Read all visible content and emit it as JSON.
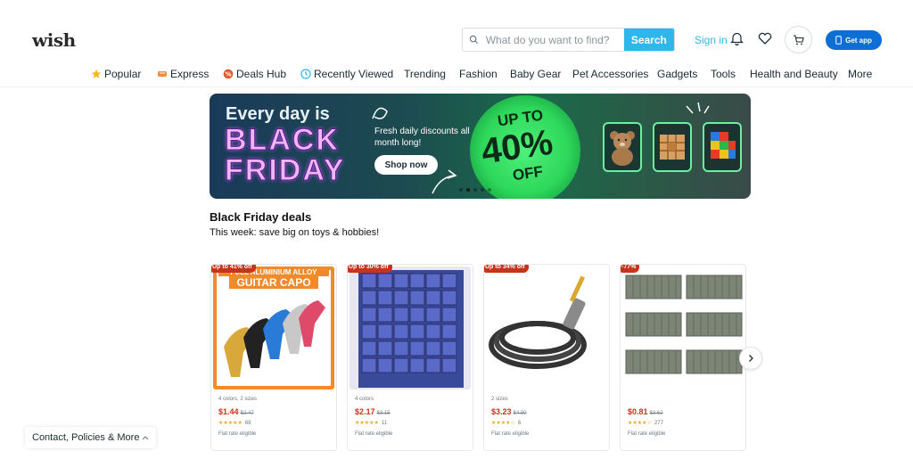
{
  "header": {
    "logo": "wish",
    "search": {
      "placeholder": "What do you want to find?",
      "value": "",
      "button": "Search"
    },
    "sign_in": "Sign in",
    "get_app": "Get app"
  },
  "nav": {
    "items": [
      {
        "label": "Popular",
        "icon": "star-icon"
      },
      {
        "label": "Express",
        "icon": "express-icon"
      },
      {
        "label": "Deals Hub",
        "icon": "deals-icon"
      },
      {
        "label": "Recently Viewed",
        "icon": "clock-icon"
      },
      {
        "label": "Trending"
      },
      {
        "label": "Fashion"
      },
      {
        "label": "Baby Gear"
      },
      {
        "label": "Pet Accessories"
      },
      {
        "label": "Gadgets"
      },
      {
        "label": "Tools"
      },
      {
        "label": "Health and Beauty"
      },
      {
        "label": "More"
      }
    ]
  },
  "banner": {
    "line1": "Every day is",
    "line2": "BLACK",
    "line3": "FRIDAY",
    "subtitle": "Fresh daily discounts all month long!",
    "cta": "Shop now",
    "upto": "UP TO",
    "percent": "40%",
    "off": "OFF"
  },
  "section": {
    "title": "Black Friday deals",
    "subtitle": "This week: save big on toys & hobbies!"
  },
  "products": [
    {
      "badge": "Up to 41% off",
      "image_text": "FULL ALUMINIUM ALLOY",
      "image_title": "GUITAR CAPO",
      "meta": "4 colors, 2 sizes",
      "price": "$1.44",
      "old_price": "$2.47",
      "stars": "★★★★★",
      "reviews": "68",
      "shipping": "Flat rate eligible"
    },
    {
      "badge": "Up to 30% off",
      "meta": "4 colors",
      "price": "$2.17",
      "old_price": "$3.15",
      "stars": "★★★★★",
      "reviews": "11",
      "shipping": "Flat rate eligible"
    },
    {
      "badge": "Up to 34% off",
      "meta": "2 sizes",
      "price": "$3.23",
      "old_price": "$4.90",
      "stars": "★★★★☆",
      "reviews": "6",
      "shipping": "Flat rate eligible"
    },
    {
      "badge": "-77%",
      "meta": "",
      "price": "$0.81",
      "old_price": "$3.62",
      "stars": "★★★★☆",
      "reviews": "277",
      "shipping": "Flat rate eligible"
    }
  ],
  "footer": {
    "link": "Contact, Policies & More"
  },
  "colors": {
    "accent": "#2fb7ec",
    "price": "#c8331b",
    "app_button": "#0d6ed6"
  }
}
